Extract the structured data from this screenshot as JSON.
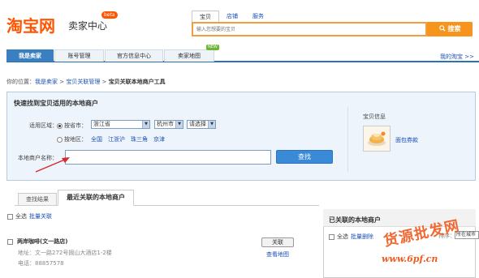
{
  "header": {
    "logo": "淘宝网",
    "subtitle": "卖家中心",
    "beta": "beta",
    "search_tabs": [
      "宝贝",
      "店铺",
      "服务"
    ],
    "search_placeholder": "输入您想要的宝贝",
    "search_button": "搜索"
  },
  "nav": {
    "items": [
      "我是卖家",
      "账号管理",
      "官方信息中心",
      "卖家地图"
    ],
    "new_badge": "NEW",
    "my_taobao": "我的淘宝 >>"
  },
  "breadcrumb": {
    "prefix": "你的位置：",
    "items": [
      "我是卖家",
      "宝贝关联管理",
      "宝贝关联本地商户工具"
    ],
    "separator": ">"
  },
  "finder": {
    "title": "快速找到宝贝适用的本地商户",
    "region_label": "适用区域：",
    "city_option": "按省市：",
    "province": "浙江省",
    "city": "杭州市",
    "district": "请选择",
    "area_option": "按地区：",
    "areas": [
      "全国",
      "江浙沪",
      "珠三角",
      "京津"
    ],
    "name_label": "本地商户名称：",
    "find_button": "查找",
    "item_info_label": "宝贝信息",
    "item_name": "面包券款"
  },
  "tabs": {
    "search_results": "查找结果",
    "recent": "最近关联的本地商户"
  },
  "list": {
    "select_all": "全选",
    "batch_assoc": "批量关联",
    "merchant": {
      "name": "两岸咖啡(文一路店)",
      "address": "地址：文一路272号掘山大酒店1-2楼",
      "phone": "电话：88857578",
      "assoc_button": "关联",
      "view_map": "查看地图"
    }
  },
  "associated": {
    "title": "已关联的本地商户",
    "select_all": "全选",
    "batch_delete": "批量删除",
    "sort_label": "排序：",
    "sort_value": "所在城市"
  },
  "watermark": {
    "line1": "货源批发网",
    "line2": "www.6pf.cn"
  }
}
